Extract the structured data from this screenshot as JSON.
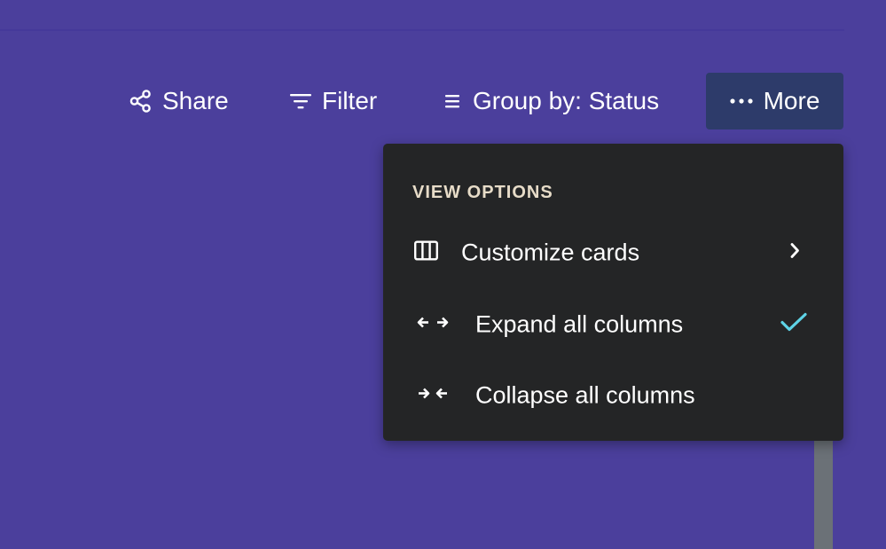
{
  "toolbar": {
    "share_label": "Share",
    "filter_label": "Filter",
    "group_label": "Group by: Status",
    "more_label": "More"
  },
  "menu": {
    "heading": "VIEW OPTIONS",
    "items": [
      {
        "label": "Customize cards",
        "icon": "columns-icon",
        "trailing": "chevron-right-icon"
      },
      {
        "label": "Expand all columns",
        "icon": "expand-arrows-icon",
        "trailing": "checkmark-icon",
        "checked": true
      },
      {
        "label": "Collapse all columns",
        "icon": "collapse-arrows-icon"
      }
    ]
  },
  "colors": {
    "background": "#4b3f9c",
    "menu_background": "#242526",
    "more_button_background": "#2d3b6a",
    "heading_color": "#e7dcc8",
    "checkmark_color": "#5ed3e6"
  }
}
